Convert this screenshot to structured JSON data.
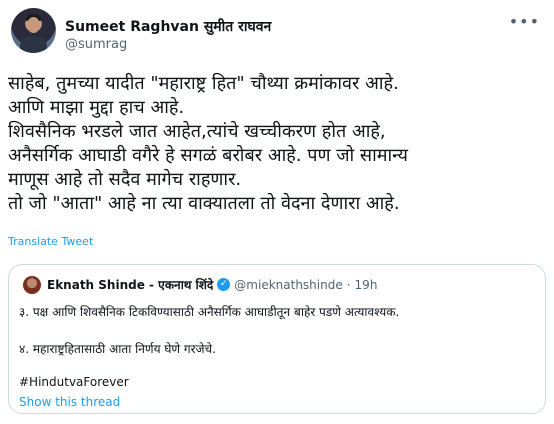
{
  "author": {
    "display_name": "Sumeet Raghvan सुमीत राघवन",
    "handle": "@sumrag",
    "avatar_icon": "user-avatar"
  },
  "menu_icon": "more-icon",
  "tweet_lines": [
    "साहेब, तुमच्या यादीत \"महाराष्ट्र हित\" चौथ्या क्रमांकावर आहे.",
    "आणि माझा मुद्दा हाच आहे.",
    "शिवसैनिक भरडले जात आहेत,त्यांचे खच्चीकरण होत आहे,",
    "अनैसर्गिक आघाडी वगैरे हे सगळं बरोबर आहे. पण जो सामान्य",
    "माणूस आहे तो सदैव मागेच राहणार.",
    "तो जो \"आता\" आहे ना त्या वाक्यातला तो वेदना देणारा आहे."
  ],
  "translate_label": "Translate Tweet",
  "quoted": {
    "display_name": "Eknath Shinde - एकनाथ शिंदे",
    "verified_icon": "verified-badge-icon",
    "handle": "@mieknathshinde",
    "separator": "·",
    "time": "19h",
    "line1": "३. पक्ष आणि शिवसैनिक टिकविण्यासाठी अनैसर्गिक आघाडीतून बाहेर पडणे अत्यावश्यक.",
    "line2": "४. महाराष्ट्रहितासाठी आता निर्णय घेणे गरजेचे.",
    "hashtag": "#HindutvaForever",
    "show_thread": "Show this thread"
  },
  "colors": {
    "link_blue": "#1d9bf0",
    "secondary_text": "#536471",
    "border": "#cfd9de"
  }
}
